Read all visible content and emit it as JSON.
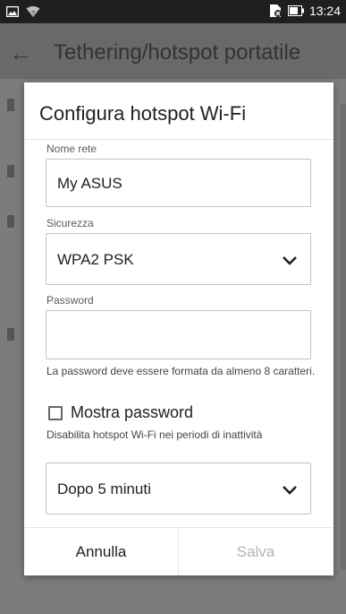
{
  "status_bar": {
    "time": "13:24",
    "icons": [
      "image-notification-icon",
      "wifi-icon",
      "no-sim-icon",
      "battery-icon"
    ]
  },
  "app": {
    "title": "Tethering/hotspot portatile",
    "back_icon": "back-arrow-icon"
  },
  "dialog": {
    "title": "Configura hotspot Wi-Fi",
    "network_name": {
      "label": "Nome rete",
      "value": "My ASUS"
    },
    "security": {
      "label": "Sicurezza",
      "selected": "WPA2 PSK"
    },
    "password": {
      "label": "Password",
      "value": "",
      "helper": "La password deve essere formata da almeno 8 caratteri."
    },
    "show_password": {
      "label": "Mostra password",
      "checked": false
    },
    "inactivity": {
      "label": "Disabilita hotspot Wi-Fi nei periodi di inattività",
      "selected": "Dopo 5 minuti"
    },
    "buttons": {
      "cancel": "Annulla",
      "save": "Salva"
    }
  },
  "colors": {
    "text_primary": "#212121",
    "disabled": "#b3b3b3",
    "scrim": "#7c7c7c"
  }
}
